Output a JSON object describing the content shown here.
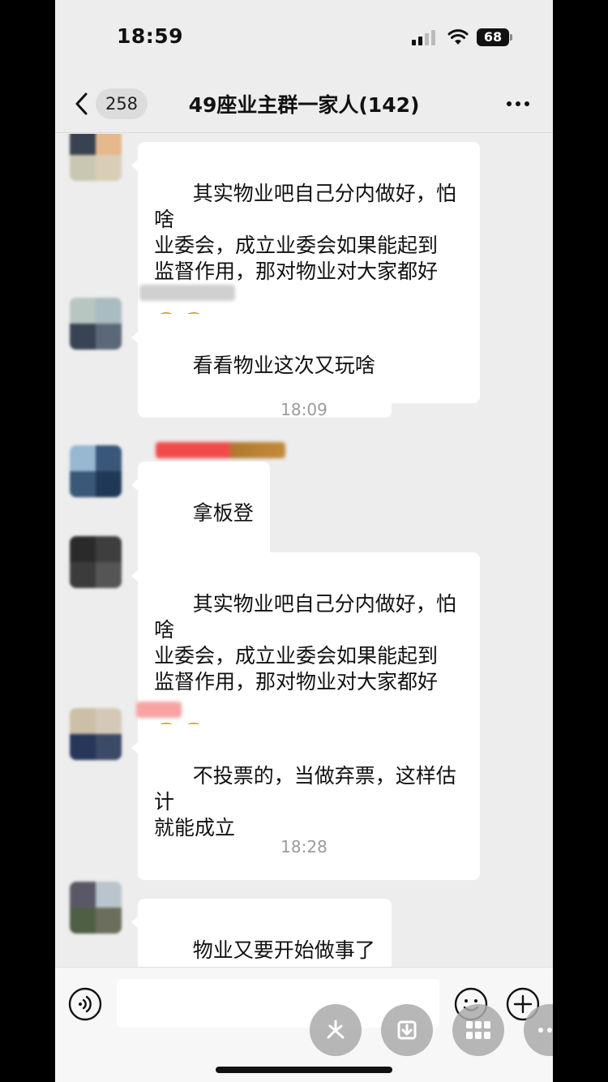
{
  "status_bar": {
    "time": "18:59",
    "battery": "68"
  },
  "nav": {
    "unread_count": "258",
    "title": "49座业主群一家人(142)"
  },
  "messages": [
    {
      "text": "其实物业吧自己分内做好，怕啥\n业委会，成立业委会如果能起到\n监督作用，那对物业对大家都好",
      "emoji": "grinning-face x2"
    },
    {
      "text": "看看物业这次又玩啥"
    },
    {
      "text": "拿板登"
    },
    {
      "text": "其实物业吧自己分内做好，怕啥\n业委会，成立业委会如果能起到\n监督作用，那对物业对大家都好",
      "emoji": "grinning-face x2"
    },
    {
      "text": "不投票的，当做弃票，这样估计\n就能成立"
    },
    {
      "text": "物业又要开始做事了"
    }
  ],
  "timestamps": [
    "18:09",
    "18:28"
  ],
  "input": {
    "value": "",
    "placeholder": ""
  },
  "icons": {
    "back": "chevron-left-icon",
    "more": "ellipsis-icon",
    "voice": "voice-icon",
    "emoji": "smiley-icon",
    "plus": "plus-icon",
    "float": [
      "pinwheel-icon",
      "download-icon",
      "grid-icon",
      "ellipsis-icon"
    ]
  },
  "colors": {
    "chat_bg": "#ededed",
    "bubble": "#ffffff",
    "timestamp": "#9b9b9b"
  }
}
